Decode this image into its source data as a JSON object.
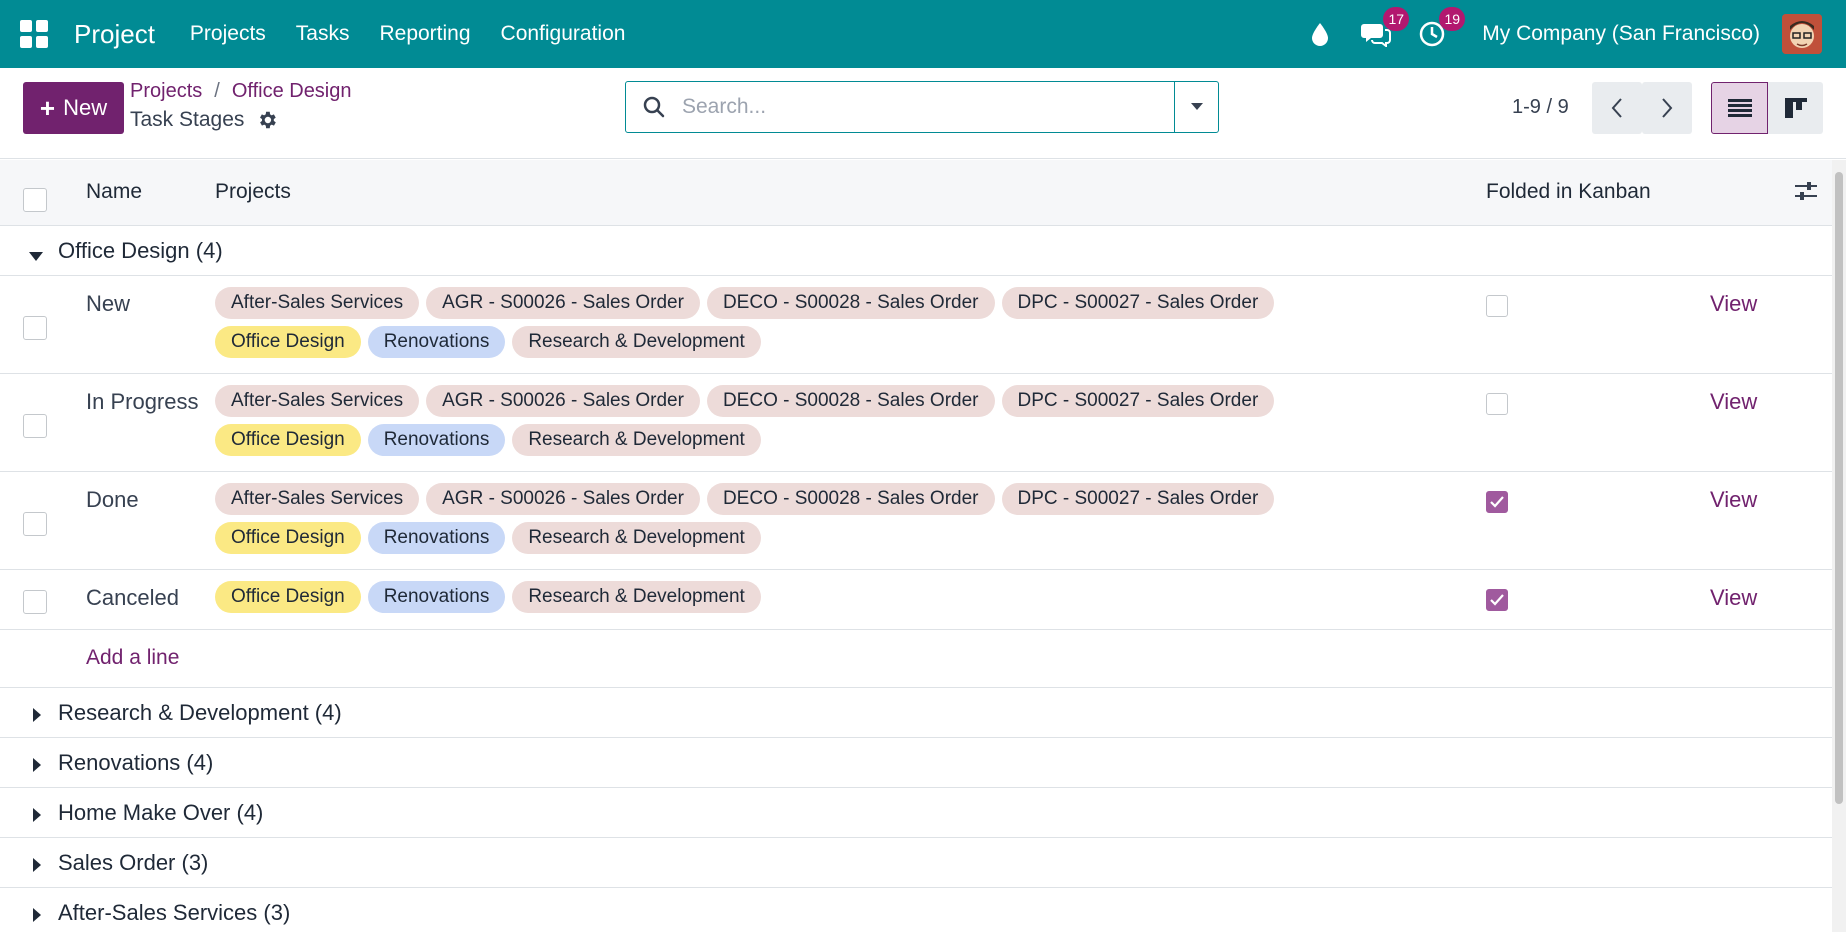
{
  "navbar": {
    "app_name": "Project",
    "menu": [
      "Projects",
      "Tasks",
      "Reporting",
      "Configuration"
    ],
    "messages_count": "17",
    "activities_count": "19",
    "company": "My Company (San Francisco)"
  },
  "control": {
    "new_label": "New",
    "breadcrumb": [
      "Projects",
      "Office Design"
    ],
    "breadcrumb_sep": "/",
    "title": "Task Stages",
    "search_placeholder": "Search...",
    "pager": "1-9 / 9"
  },
  "table": {
    "headers": {
      "name": "Name",
      "projects": "Projects",
      "folded": "Folded in Kanban"
    },
    "view_label": "View",
    "add_line": "Add a line"
  },
  "colors": {
    "grey_tag": "#eddbd9",
    "yellow_tag": "#fbe984",
    "blue_tag": "#c8d8f7",
    "brand": "#71226e",
    "navbar": "#018b94"
  },
  "groups": [
    {
      "label": "Office Design (4)",
      "expanded": true,
      "rows": [
        {
          "name": "New",
          "folded": false,
          "tags": [
            {
              "text": "After-Sales Services",
              "color": "grey"
            },
            {
              "text": "AGR - S00026 - Sales Order",
              "color": "grey"
            },
            {
              "text": "DECO - S00028 - Sales Order",
              "color": "grey"
            },
            {
              "text": "DPC - S00027 - Sales Order",
              "color": "grey"
            },
            {
              "text": "Office Design",
              "color": "yellow"
            },
            {
              "text": "Renovations",
              "color": "blue"
            },
            {
              "text": "Research & Development",
              "color": "grey"
            }
          ]
        },
        {
          "name": "In Progress",
          "folded": false,
          "tags": [
            {
              "text": "After-Sales Services",
              "color": "grey"
            },
            {
              "text": "AGR - S00026 - Sales Order",
              "color": "grey"
            },
            {
              "text": "DECO - S00028 - Sales Order",
              "color": "grey"
            },
            {
              "text": "DPC - S00027 - Sales Order",
              "color": "grey"
            },
            {
              "text": "Office Design",
              "color": "yellow"
            },
            {
              "text": "Renovations",
              "color": "blue"
            },
            {
              "text": "Research & Development",
              "color": "grey"
            }
          ]
        },
        {
          "name": "Done",
          "folded": true,
          "tags": [
            {
              "text": "After-Sales Services",
              "color": "grey"
            },
            {
              "text": "AGR - S00026 - Sales Order",
              "color": "grey"
            },
            {
              "text": "DECO - S00028 - Sales Order",
              "color": "grey"
            },
            {
              "text": "DPC - S00027 - Sales Order",
              "color": "grey"
            },
            {
              "text": "Office Design",
              "color": "yellow"
            },
            {
              "text": "Renovations",
              "color": "blue"
            },
            {
              "text": "Research & Development",
              "color": "grey"
            }
          ]
        },
        {
          "name": "Canceled",
          "folded": true,
          "tags": [
            {
              "text": "Office Design",
              "color": "yellow"
            },
            {
              "text": "Renovations",
              "color": "blue"
            },
            {
              "text": "Research & Development",
              "color": "grey"
            }
          ]
        }
      ]
    },
    {
      "label": "Research & Development (4)",
      "expanded": false
    },
    {
      "label": "Renovations (4)",
      "expanded": false
    },
    {
      "label": "Home Make Over (4)",
      "expanded": false
    },
    {
      "label": "Sales Order (3)",
      "expanded": false
    },
    {
      "label": "After-Sales Services (3)",
      "expanded": false
    }
  ]
}
